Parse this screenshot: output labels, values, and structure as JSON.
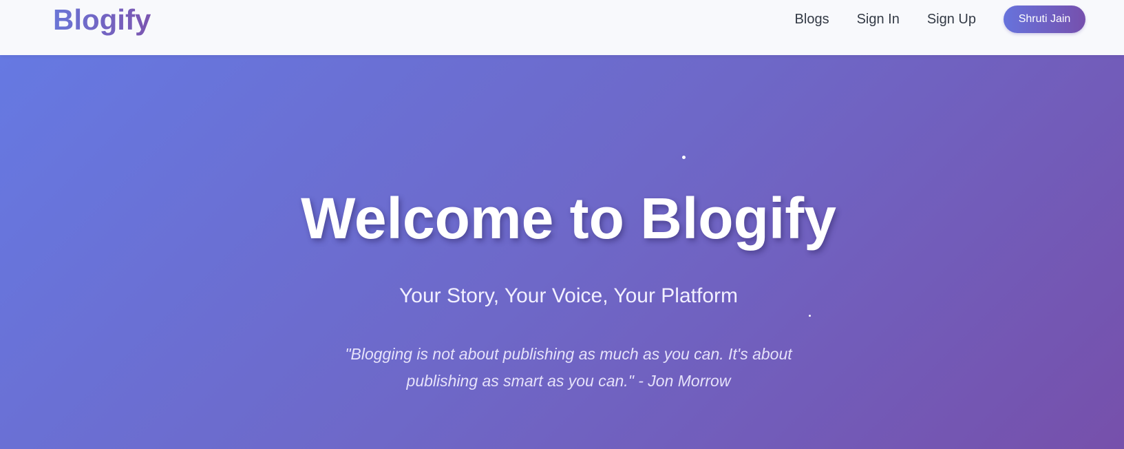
{
  "header": {
    "logo": "Blogify",
    "nav": {
      "blogs": "Blogs",
      "sign_in": "Sign In",
      "sign_up": "Sign Up"
    },
    "user_button": "Shruti Jain"
  },
  "hero": {
    "title": "Welcome to Blogify",
    "subtitle": "Your Story, Your Voice, Your Platform",
    "quote": "\"Blogging is not about publishing as much as you can. It's about publishing as smart as you can.\" - Jon Morrow"
  },
  "colors": {
    "accent_start": "#6773dc",
    "accent_end": "#7650ad",
    "hero_start": "#6679e2",
    "hero_end": "#7650ab",
    "nav_text": "#333a45",
    "navbar_bg": "#f8f9fc"
  }
}
